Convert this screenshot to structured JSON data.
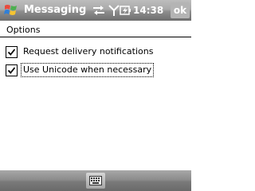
{
  "titlebar": {
    "app_title": "Messaging",
    "time": "14:38",
    "ok_label": "ok",
    "icons": [
      "start-menu-icon",
      "connectivity-icon",
      "signal-strength-icon",
      "battery-icon"
    ]
  },
  "options": {
    "header": "Options",
    "items": [
      {
        "label": "Request delivery notifications",
        "checked": true
      },
      {
        "label": "Use Unicode when necessary",
        "checked": true,
        "focused": true
      }
    ]
  },
  "menubar": {
    "icons": [
      "keyboard-icon"
    ]
  },
  "colors": {
    "titlebar": "#8e8e8e",
    "menubar": "#7a7a7a",
    "background": "#ffffff",
    "text": "#000000"
  }
}
